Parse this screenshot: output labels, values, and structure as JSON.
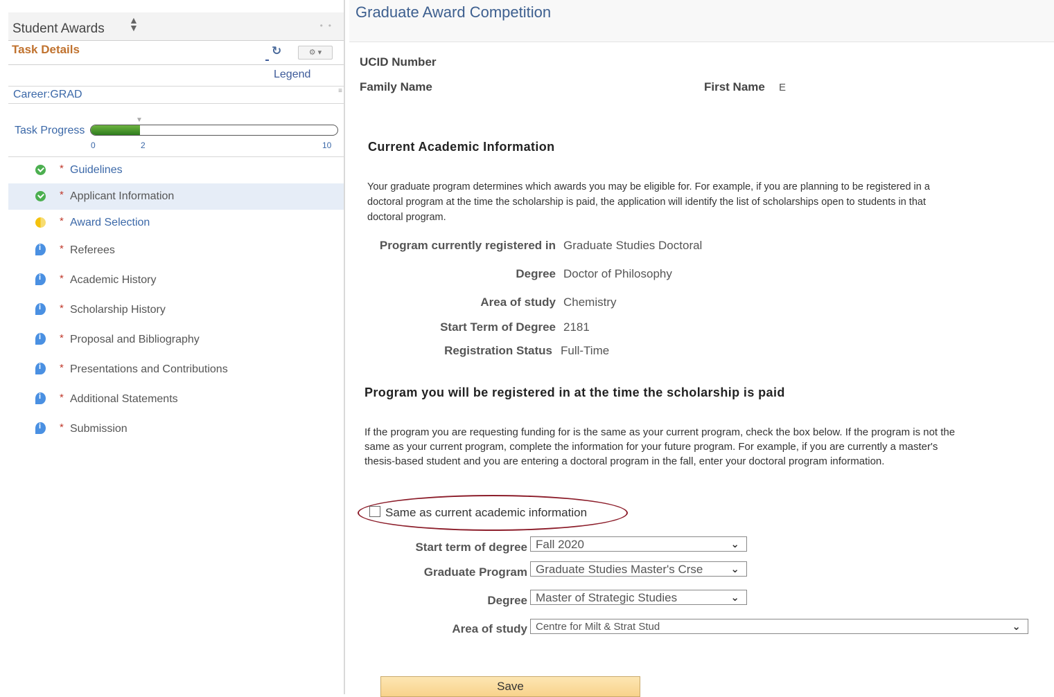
{
  "left_panel": {
    "title": "Student Awards",
    "task_details_label": "Task Details",
    "legend_label": "Legend",
    "career_label": "Career:GRAD",
    "progress": {
      "label": "Task Progress",
      "min": "0",
      "current": "2",
      "max": "10",
      "value": 2,
      "total": 10
    },
    "tasks": [
      {
        "label": "Guidelines",
        "status": "done",
        "style": "link"
      },
      {
        "label": "Applicant Information",
        "status": "done",
        "style": "plain",
        "selected": true
      },
      {
        "label": "Award Selection",
        "status": "partial",
        "style": "link"
      },
      {
        "label": "Referees",
        "status": "info",
        "style": "plain"
      },
      {
        "label": "Academic History",
        "status": "info",
        "style": "plain"
      },
      {
        "label": "Scholarship History",
        "status": "info",
        "style": "plain"
      },
      {
        "label": "Proposal and Bibliography",
        "status": "info",
        "style": "plain"
      },
      {
        "label": "Presentations and Contributions",
        "status": "info",
        "style": "plain"
      },
      {
        "label": "Additional Statements",
        "status": "info",
        "style": "plain"
      },
      {
        "label": "Submission",
        "status": "info",
        "style": "plain"
      }
    ],
    "required_marker": "*"
  },
  "header": {
    "title": "Graduate Award Competition"
  },
  "applicant": {
    "ucid_label": "UCID Number",
    "family_name_label": "Family Name",
    "first_name_label": "First Name",
    "first_name_value": "E"
  },
  "current_academic": {
    "title": "Current Academic Information",
    "description": "Your graduate program determines which awards you may be eligible for. For example, if you are planning to be registered in a doctoral program at the time the scholarship is paid, the application will identify the list of scholarships open to students in that doctoral program.",
    "fields": [
      {
        "label": "Program currently registered in",
        "value": "Graduate Studies Doctoral"
      },
      {
        "label": "Degree",
        "value": "Doctor of Philosophy"
      },
      {
        "label": "Area of study",
        "value": "Chemistry"
      },
      {
        "label": "Start Term of Degree",
        "value": "2181"
      },
      {
        "label": "Registration Status",
        "value": "Full-Time"
      }
    ]
  },
  "future_program": {
    "title": "Program you will be registered in at the time the scholarship is paid",
    "description": "If the program you are requesting funding for is the same as your current program, check the box below. If the program is not the same as your current program, complete the information for your future program. For example, if you are currently a master's thesis-based student and you are entering a doctoral program in the fall, enter your doctoral program information.",
    "same_checkbox_label": "Same as current academic information",
    "same_checked": false,
    "selects": [
      {
        "label": "Start term of degree",
        "value": "Fall 2020"
      },
      {
        "label": "Graduate Program",
        "value": "Graduate Studies Master's Crse"
      },
      {
        "label": "Degree",
        "value": "Master of Strategic Studies"
      },
      {
        "label": "Area of study",
        "value": "Centre for Milt & Strat Stud"
      }
    ]
  },
  "actions": {
    "save_label": "Save"
  },
  "colors": {
    "accent_orange": "#c0722e",
    "link_blue": "#3b68a8",
    "progress_green": "#2f7d1f",
    "highlight_maroon": "#8c1d2a",
    "save_button": "#f8d28b"
  }
}
